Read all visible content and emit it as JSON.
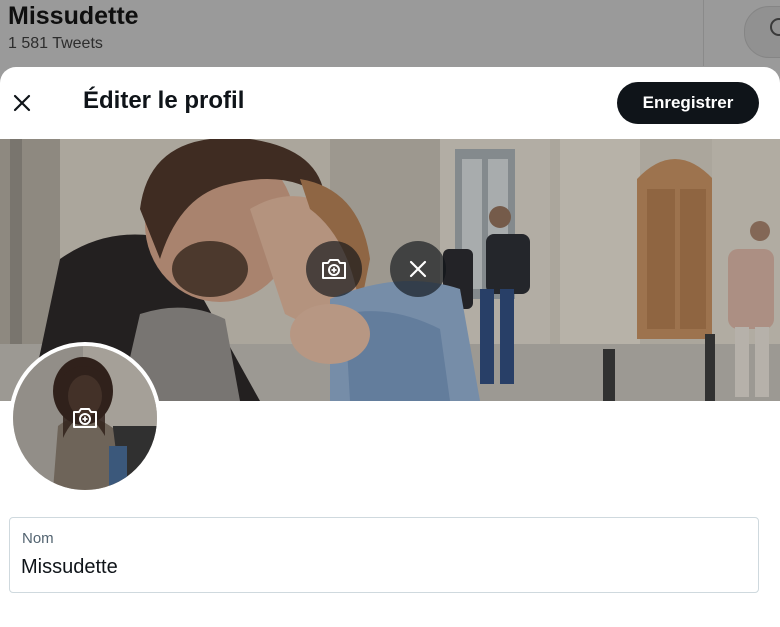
{
  "background_profile": {
    "name": "Missudette",
    "tweet_count": "1 581 Tweets",
    "search_icon": "search-icon"
  },
  "modal": {
    "title": "Éditer le profil",
    "close_icon": "close-icon",
    "save_label": "Enregistrer"
  },
  "banner": {
    "add_photo_icon": "camera-plus-icon",
    "remove_photo_icon": "close-icon"
  },
  "avatar": {
    "add_photo_icon": "camera-plus-icon"
  },
  "name_field": {
    "label": "Nom",
    "value": "Missudette"
  },
  "colors": {
    "primary_button": "#0f1419",
    "text_primary": "#0f1419",
    "text_secondary": "#536471",
    "field_border": "#cfd9de"
  }
}
